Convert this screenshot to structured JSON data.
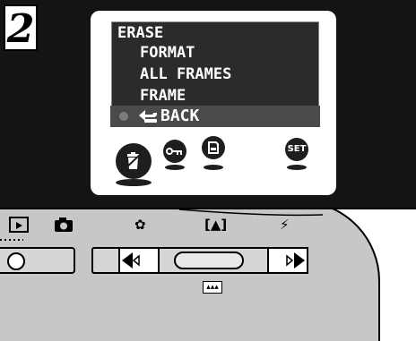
{
  "step": {
    "number": "2"
  },
  "lcd_menu": {
    "title": "ERASE",
    "items": [
      "FORMAT",
      "ALL FRAMES",
      "FRAME"
    ],
    "selected_item": "BACK"
  },
  "lcd_icons": [
    "erase-icon",
    "protect-key-icon",
    "print-order-icon",
    "set-icon"
  ],
  "lcd_icon_labels": {
    "set": "SET"
  },
  "camera_panel": {
    "labels": {
      "macro": "✿",
      "flash": "⚡"
    },
    "display_label": "[▲]",
    "indicator_label": "▴▴▴"
  },
  "colors": {
    "panel": "#141414",
    "body": "#c7c7c7",
    "menu_bg": "#2b2b2b",
    "selection": "#4a4a4a"
  }
}
